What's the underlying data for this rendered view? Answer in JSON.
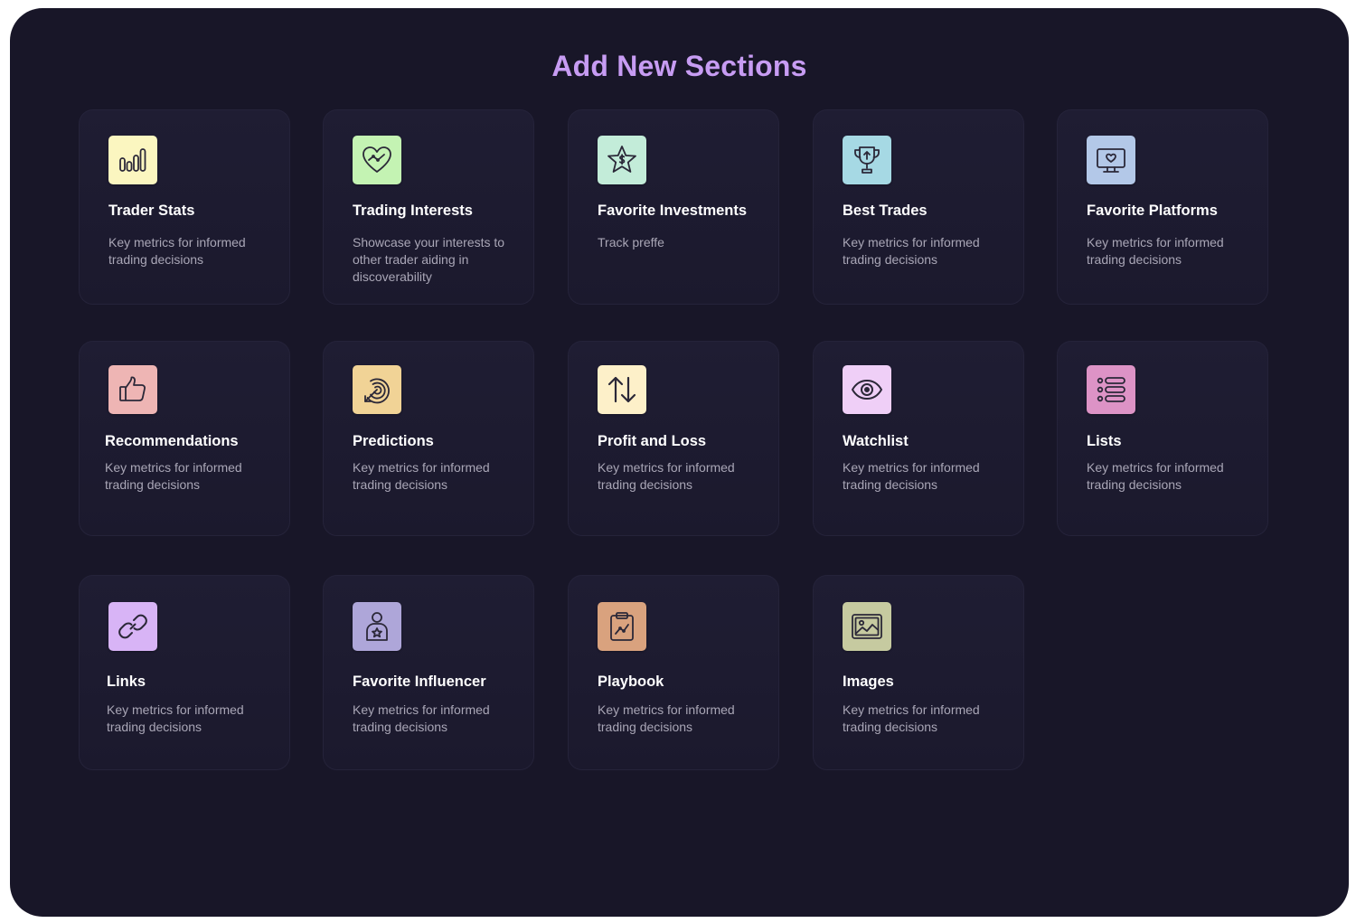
{
  "header": {
    "title": "Add New Sections"
  },
  "sections": [
    {
      "title": "Trader Stats",
      "description": "Key metrics for informed trading decisions",
      "icon": "bar-chart-icon",
      "icon_bg": "#fbf6c0"
    },
    {
      "title": "Trading Interests",
      "description": "Showcase your interests to other trader aiding in discoverability",
      "icon": "heart-chart-icon",
      "icon_bg": "#c4f3b3"
    },
    {
      "title": "Favorite Investments",
      "description": "Track preffe",
      "icon": "star-dollar-icon",
      "icon_bg": "#c3ecd9"
    },
    {
      "title": "Best Trades",
      "description": "Key metrics for informed trading decisions",
      "icon": "trophy-icon",
      "icon_bg": "#a6d9e4"
    },
    {
      "title": "Favorite Platforms",
      "description": "Key metrics for informed trading decisions",
      "icon": "monitor-heart-icon",
      "icon_bg": "#b3c8e8"
    },
    {
      "title": "Recommendations",
      "description": "Key metrics for informed trading decisions",
      "icon": "thumbs-up-icon",
      "icon_bg": "#eeb5b4"
    },
    {
      "title": "Predictions",
      "description": "Key metrics for informed trading decisions",
      "icon": "target-arrow-icon",
      "icon_bg": "#f1d396"
    },
    {
      "title": "Profit and Loss",
      "description": "Key metrics for informed trading decisions",
      "icon": "up-down-arrows-icon",
      "icon_bg": "#fdf0c9"
    },
    {
      "title": "Watchlist",
      "description": "Key metrics for informed trading decisions",
      "icon": "eye-icon",
      "icon_bg": "#efcff7"
    },
    {
      "title": "Lists",
      "description": "Key metrics for informed trading decisions",
      "icon": "list-icon",
      "icon_bg": "#dd93c6"
    },
    {
      "title": "Links",
      "description": "Key metrics for informed trading decisions",
      "icon": "link-icon",
      "icon_bg": "#d8b4f6"
    },
    {
      "title": "Favorite Influencer",
      "description": "Key metrics for informed trading decisions",
      "icon": "person-star-icon",
      "icon_bg": "#aea6d9"
    },
    {
      "title": "Playbook",
      "description": "Key metrics for informed trading decisions",
      "icon": "clipboard-chart-icon",
      "icon_bg": "#d9a27e"
    },
    {
      "title": "Images",
      "description": "Key metrics for informed trading decisions",
      "icon": "image-icon",
      "icon_bg": "#c6caa0"
    }
  ]
}
